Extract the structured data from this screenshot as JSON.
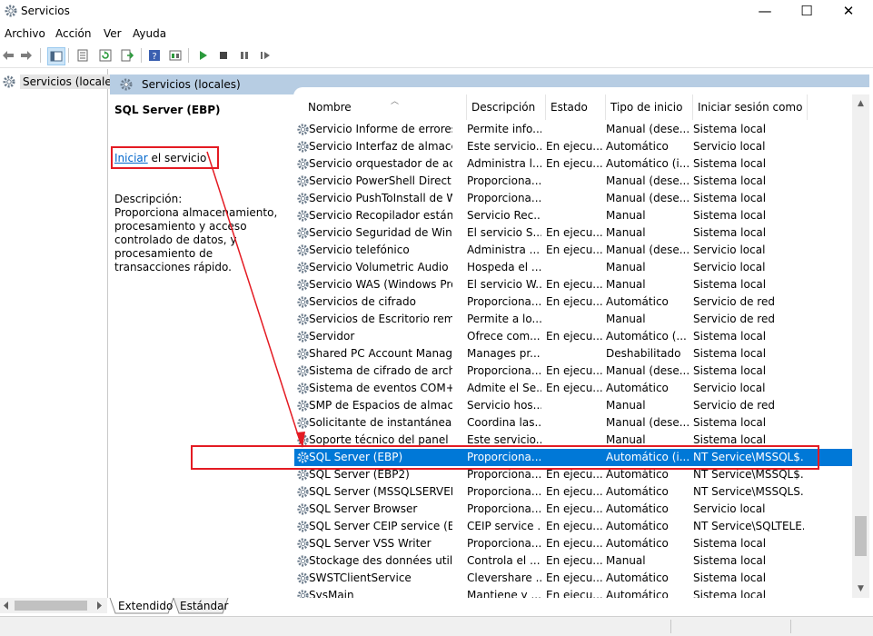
{
  "window": {
    "title": "Servicios",
    "controls": {
      "minimize": "—",
      "maximize": "☐",
      "close": "✕"
    }
  },
  "menu": [
    "Archivo",
    "Acción",
    "Ver",
    "Ayuda"
  ],
  "toolbar": {
    "icons": [
      "back-icon",
      "forward-icon",
      "show-hide-tree-icon",
      "properties-icon",
      "refresh-icon",
      "export-list-icon",
      "help-icon",
      "view-icon",
      "play-icon",
      "stop-icon",
      "pause-icon",
      "restart-icon"
    ]
  },
  "tree": {
    "root_label": "Servicios (locales)"
  },
  "header": {
    "title": "Servicios (locales)"
  },
  "details": {
    "service_name": "SQL Server (EBP)",
    "start_link": "Iniciar",
    "start_suffix": " el servicio",
    "description_label": "Descripción:",
    "description": "Proporciona almacenamiento, procesamiento y acceso controlado de datos, y procesamiento de transacciones rápido."
  },
  "columns": [
    "Nombre",
    "Descripción",
    "Estado",
    "Tipo de inicio",
    "Iniciar sesión como"
  ],
  "rows": [
    [
      "Servicio Informe de errores ...",
      "Permite info...",
      "",
      "Manual (dese...",
      "Sistema local"
    ],
    [
      "Servicio Interfaz de almacen...",
      "Este servicio...",
      "En ejecu...",
      "Automático",
      "Servicio local"
    ],
    [
      "Servicio orquestador de act...",
      "Administra l...",
      "En ejecu...",
      "Automático (i...",
      "Sistema local"
    ],
    [
      "Servicio PowerShell Direct d...",
      "Proporciona...",
      "",
      "Manual (dese...",
      "Sistema local"
    ],
    [
      "Servicio PushToInstall de Wi...",
      "Proporciona...",
      "",
      "Manual (dese...",
      "Sistema local"
    ],
    [
      "Servicio Recopilador estánd...",
      "Servicio Rec...",
      "",
      "Manual",
      "Sistema local"
    ],
    [
      "Servicio Seguridad de Wind...",
      "El servicio S...",
      "En ejecu...",
      "Manual",
      "Sistema local"
    ],
    [
      "Servicio telefónico",
      "Administra ...",
      "En ejecu...",
      "Manual (dese...",
      "Servicio local"
    ],
    [
      "Servicio Volumetric Audio C...",
      "Hospeda el ...",
      "",
      "Manual",
      "Servicio local"
    ],
    [
      "Servicio WAS (Windows Pro...",
      "El servicio W...",
      "En ejecu...",
      "Manual",
      "Sistema local"
    ],
    [
      "Servicios de cifrado",
      "Proporciona...",
      "En ejecu...",
      "Automático",
      "Servicio de red"
    ],
    [
      "Servicios de Escritorio remoto",
      "Permite a lo...",
      "",
      "Manual",
      "Servicio de red"
    ],
    [
      "Servidor",
      "Ofrece com...",
      "En ejecu...",
      "Automático (...",
      "Sistema local"
    ],
    [
      "Shared PC Account Manager",
      "Manages pr...",
      "",
      "Deshabilitado",
      "Sistema local"
    ],
    [
      "Sistema de cifrado de archi...",
      "Proporciona...",
      "En ejecu...",
      "Manual (dese...",
      "Sistema local"
    ],
    [
      "Sistema de eventos COM+",
      "Admite el Se...",
      "En ejecu...",
      "Automático",
      "Servicio local"
    ],
    [
      "SMP de Espacios de almace...",
      "Servicio hos...",
      "",
      "Manual",
      "Servicio de red"
    ],
    [
      "Solicitante de instantáneas ...",
      "Coordina las...",
      "",
      "Manual (dese...",
      "Sistema local"
    ],
    [
      "Soporte técnico del panel d...",
      "Este servicio...",
      "",
      "Manual",
      "Sistema local"
    ],
    [
      "SQL Server (EBP)",
      "Proporciona...",
      "",
      "Automático (i...",
      "NT Service\\MSSQL$..."
    ],
    [
      "SQL Server (EBP2)",
      "Proporciona...",
      "En ejecu...",
      "Automático",
      "NT Service\\MSSQL$..."
    ],
    [
      "SQL Server (MSSQLSERVER)",
      "Proporciona...",
      "En ejecu...",
      "Automático",
      "NT Service\\MSSQLS..."
    ],
    [
      "SQL Server Browser",
      "Proporciona...",
      "En ejecu...",
      "Automático",
      "Servicio local"
    ],
    [
      "SQL Server CEIP service (EBP)",
      "CEIP service ...",
      "En ejecu...",
      "Automático",
      "NT Service\\SQLTELE..."
    ],
    [
      "SQL Server VSS Writer",
      "Proporciona...",
      "En ejecu...",
      "Automático",
      "Sistema local"
    ],
    [
      "Stockage des données utilis...",
      "Controla el ...",
      "En ejecu...",
      "Manual",
      "Sistema local"
    ],
    [
      "SWSTClientService",
      "Clevershare ...",
      "En ejecu...",
      "Automático",
      "Sistema local"
    ],
    [
      "SysMain",
      "Mantiene y ...",
      "En ejecu...",
      "Automático",
      "Sistema local"
    ]
  ],
  "selected_row_index": 19,
  "tabs": [
    "Extendido",
    "Estándar"
  ],
  "colors": {
    "selection": "#0078d7",
    "annotation": "#e41b23",
    "header_band": "#b7cde3",
    "link": "#0066cc"
  }
}
